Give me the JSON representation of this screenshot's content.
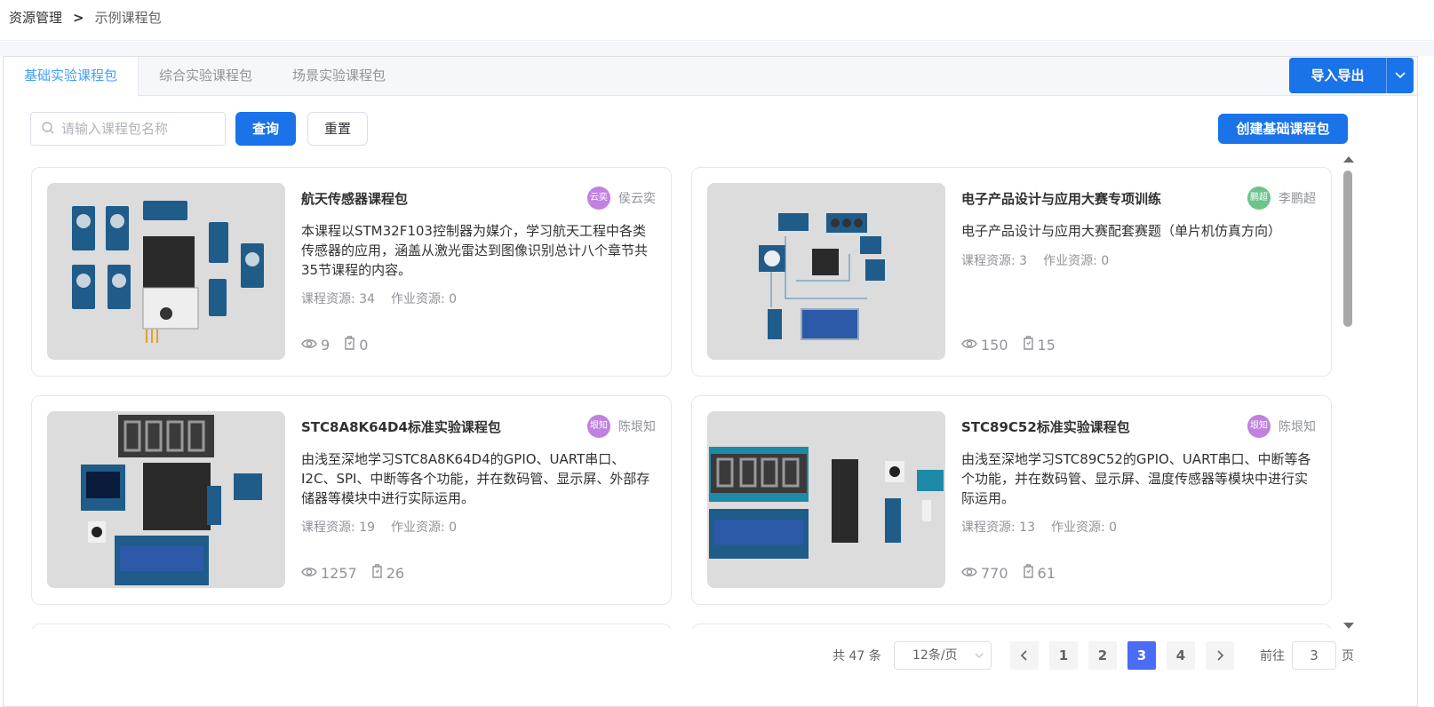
{
  "breadcrumb": {
    "root": "资源管理",
    "separator": ">",
    "current": "示例课程包"
  },
  "tabs": [
    {
      "label": "基础实验课程包",
      "active": true
    },
    {
      "label": "综合实验课程包",
      "active": false
    },
    {
      "label": "场景实验课程包",
      "active": false
    }
  ],
  "import_export_label": "导入导出",
  "search": {
    "placeholder": "请输入课程包名称",
    "value": ""
  },
  "query_label": "查询",
  "reset_label": "重置",
  "create_label": "创建基础课程包",
  "cards": [
    {
      "title": "航天传感器课程包",
      "avatar": "云奕",
      "avatar_color": "#c081e0",
      "author": "侯云奕",
      "desc": "本课程以STM32F103控制器为媒介，学习航天工程中各类传感器的应用，涵盖从激光雷达到图像识别总计八个章节共35节课程的内容。",
      "course_resources": "课程资源: 34",
      "homework_resources": "作业资源: 0",
      "views": "9",
      "favorites": "0"
    },
    {
      "title": "电子产品设计与应用大赛专项训练",
      "avatar": "鹏超",
      "avatar_color": "#6cc38b",
      "author": "李鹏超",
      "desc": "电子产品设计与应用大赛配套赛题（单片机仿真方向）",
      "course_resources": "课程资源: 3",
      "homework_resources": "作业资源: 0",
      "views": "150",
      "favorites": "15"
    },
    {
      "title": "STC8A8K64D4标准实验课程包",
      "avatar": "垠知",
      "avatar_color": "#c081e0",
      "author": "陈垠知",
      "desc": "由浅至深地学习STC8A8K64D4的GPIO、UART串口、I2C、SPI、中断等各个功能，并在数码管、显示屏、外部存储器等模块中进行实际运用。",
      "course_resources": "课程资源: 19",
      "homework_resources": "作业资源: 0",
      "views": "1257",
      "favorites": "26"
    },
    {
      "title": "STC89C52标准实验课程包",
      "avatar": "垠知",
      "avatar_color": "#c081e0",
      "author": "陈垠知",
      "desc": "由浅至深地学习STC89C52的GPIO、UART串口、中断等各个功能，并在数码管、显示屏、温度传感器等模块中进行实际运用。",
      "course_resources": "课程资源: 13",
      "homework_resources": "作业资源: 0",
      "views": "770",
      "favorites": "61"
    }
  ],
  "pagination": {
    "total": "共 47 条",
    "page_size": "12条/页",
    "pages": [
      "1",
      "2",
      "3",
      "4"
    ],
    "current": "3",
    "goto_label": "前往",
    "goto_value": "3",
    "goto_suffix": "页"
  },
  "colors": {
    "primary": "#1a73e8",
    "active_tab": "#409eff",
    "active_page": "#4a6cf7"
  }
}
